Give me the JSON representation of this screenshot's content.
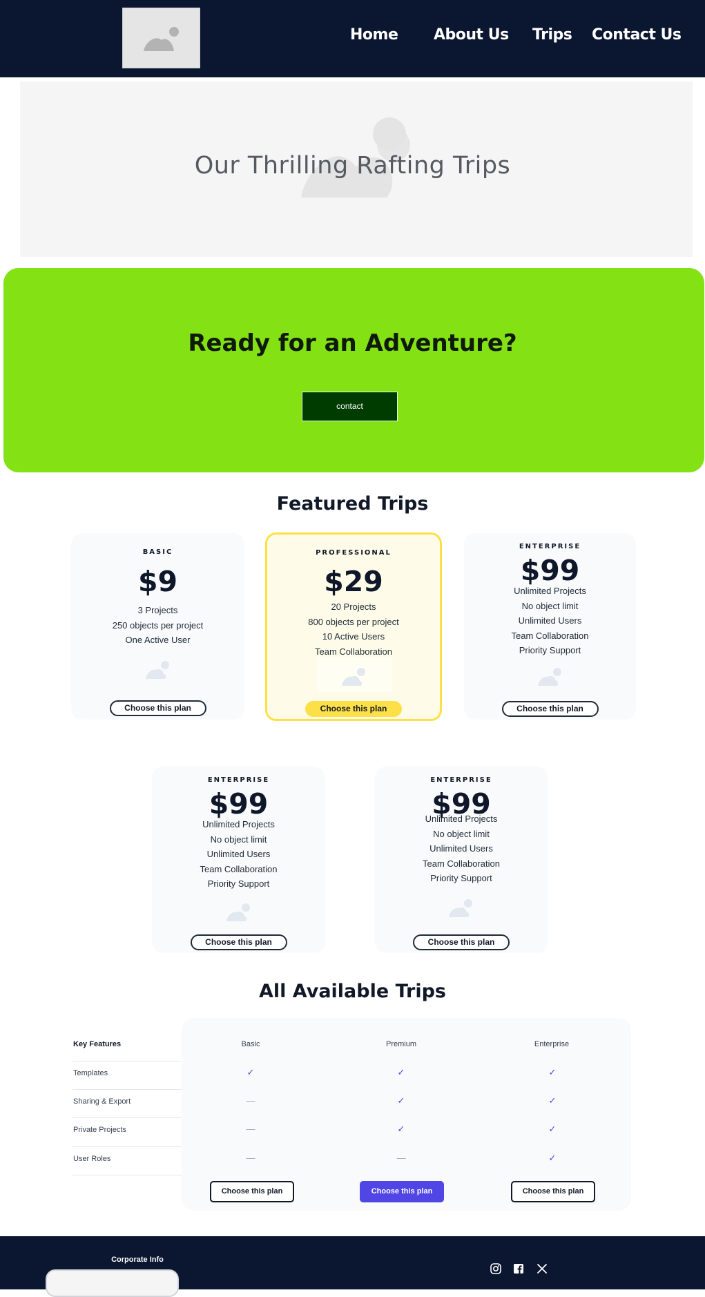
{
  "nav": {
    "logo_icon": "image-placeholder-icon",
    "links": [
      "Home",
      "About Us",
      "Trips",
      "Contact Us"
    ]
  },
  "hero": {
    "title": "Our Thrilling Rafting Trips",
    "image_icon": "image-placeholder-icon"
  },
  "cta": {
    "title": "Ready for an Adventure?",
    "button_label": "contact"
  },
  "featured": {
    "title": "Featured Trips",
    "cards": [
      {
        "name": "BASIC",
        "price": "$9",
        "features": [
          "3 Projects",
          "250 objects per project",
          "One Active User"
        ],
        "button": "Choose this plan",
        "highlighted": false
      },
      {
        "name": "PROFESSIONAL",
        "price": "$29",
        "features": [
          "20 Projects",
          "800 objects per project",
          "10 Active Users",
          "Team Collaboration"
        ],
        "button": "Choose this plan",
        "highlighted": true
      },
      {
        "name": "ENTERPRISE",
        "price": "$99",
        "features": [
          "Unlimited Projects",
          "No object limit",
          "Unlimited Users",
          "Team Collaboration",
          "Priority Support"
        ],
        "button": "Choose this plan",
        "highlighted": false
      },
      {
        "name": "ENTERPRISE",
        "price": "$99",
        "features": [
          "Unlimited Projects",
          "No object limit",
          "Unlimited Users",
          "Team Collaboration",
          "Priority Support"
        ],
        "button": "Choose this plan",
        "highlighted": false
      },
      {
        "name": "ENTERPRISE",
        "price": "$99",
        "features": [
          "Unlimited Projects",
          "No object limit",
          "Unlimited Users",
          "Team Collaboration",
          "Priority Support"
        ],
        "button": "Choose this plan",
        "highlighted": false
      }
    ]
  },
  "comparison": {
    "title": "All Available Trips",
    "key_header": "Key Features",
    "plans": [
      "Basic",
      "Premium",
      "Enterprise"
    ],
    "rows": [
      {
        "label": "Templates",
        "values": [
          true,
          true,
          true
        ]
      },
      {
        "label": "Sharing & Export",
        "values": [
          false,
          true,
          true
        ]
      },
      {
        "label": "Private Projects",
        "values": [
          false,
          true,
          true
        ]
      },
      {
        "label": "User Roles",
        "values": [
          false,
          false,
          true
        ]
      }
    ],
    "check_symbol": "✓",
    "dash_symbol": "—",
    "buttons": [
      "Choose this plan",
      "Choose this plan",
      "Choose this plan"
    ]
  },
  "footer": {
    "title": "Corporate Info",
    "social_icons": [
      "instagram-icon",
      "facebook-icon",
      "x-icon"
    ]
  },
  "colors": {
    "nav_bg": "#0b1630",
    "cta_bg": "#84e114",
    "cta_button": "#003c00",
    "featured_border": "#fde047",
    "primary_button": "#4f46e5"
  }
}
